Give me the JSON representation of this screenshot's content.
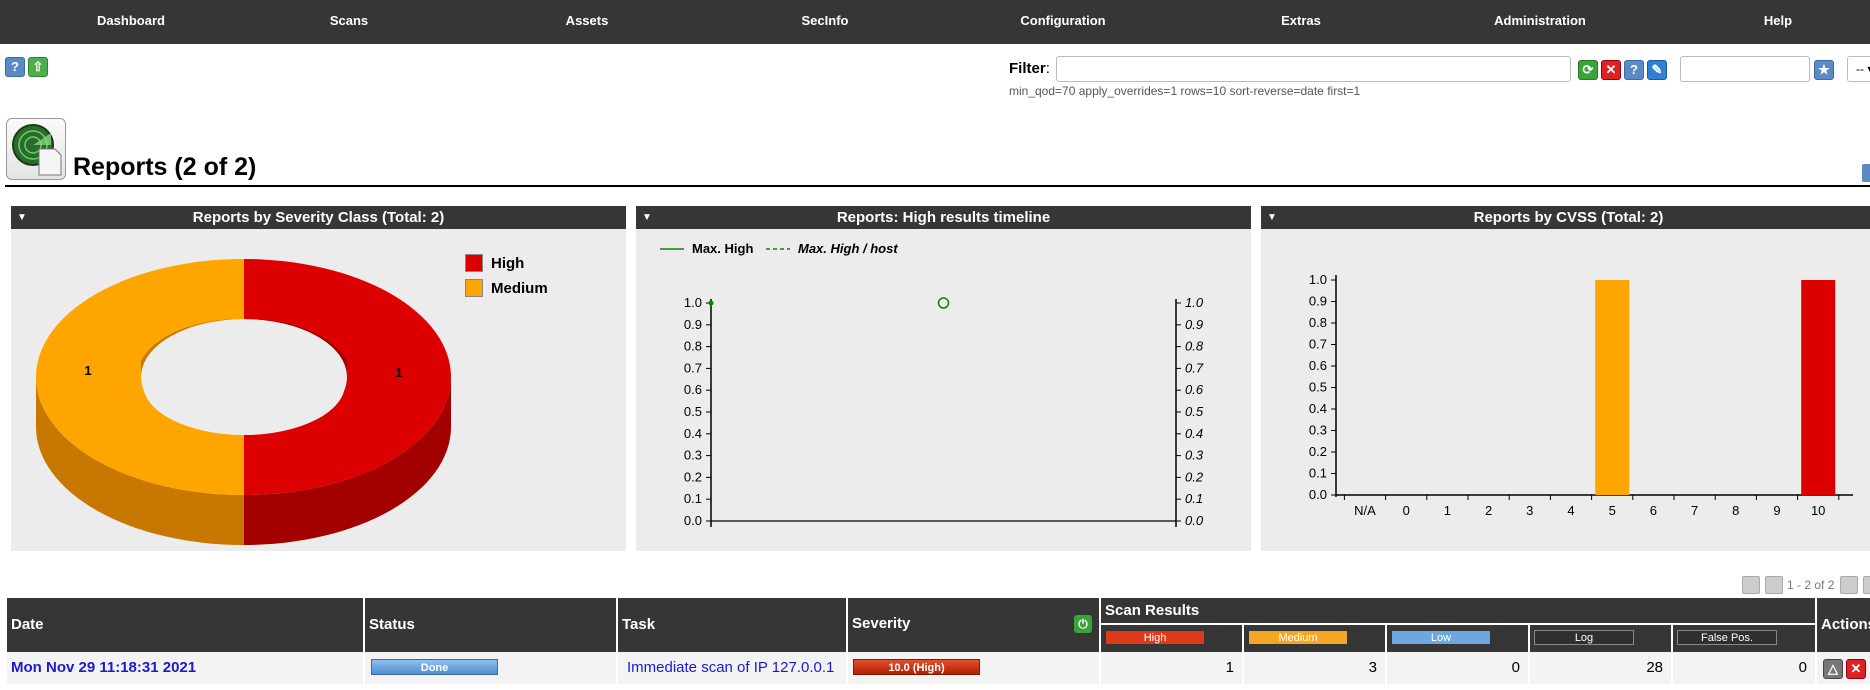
{
  "nav": {
    "items": [
      "Dashboard",
      "Scans",
      "Assets",
      "SecInfo",
      "Configuration",
      "Extras",
      "Administration",
      "Help"
    ]
  },
  "toolbar": {
    "help_icon": "?",
    "upload_icon": "⇧"
  },
  "filter": {
    "label": "Filter",
    "colon": ":",
    "value": "",
    "query_text": "min_qod=70 apply_overrides=1 rows=10 sort-reverse=date first=1",
    "select_value": "-- ▾"
  },
  "page": {
    "title": "Reports (2 of 2)"
  },
  "panels": [
    {
      "title": "Reports by Severity Class (Total: 2)"
    },
    {
      "title": "Reports: High results timeline"
    },
    {
      "title": "Reports by CVSS (Total: 2)"
    }
  ],
  "colors": {
    "high": "#dd0000",
    "medium": "#ffa500",
    "low": "#6ea6df",
    "log": "#333333",
    "nav": "#363636"
  },
  "chart_data": [
    {
      "type": "pie",
      "title": "Reports by Severity Class (Total: 2)",
      "categories": [
        "High",
        "Medium"
      ],
      "values": [
        1,
        1
      ],
      "value_labels": [
        "1",
        "1"
      ],
      "legend": "top-right",
      "donut": true
    },
    {
      "type": "line",
      "title": "Reports: High results timeline",
      "series": [
        {
          "name": "Max. High",
          "values": [
            1.0
          ]
        },
        {
          "name": "Max. High / host",
          "values": [
            1.0
          ]
        }
      ],
      "ylim": [
        0.0,
        1.0
      ],
      "y_ticks": [
        "0.0",
        "0.1",
        "0.2",
        "0.3",
        "0.4",
        "0.5",
        "0.6",
        "0.7",
        "0.8",
        "0.9",
        "1.0"
      ],
      "legend": "top-left"
    },
    {
      "type": "bar",
      "title": "Reports by CVSS (Total: 2)",
      "categories": [
        "N/A",
        "0",
        "1",
        "2",
        "3",
        "4",
        "5",
        "6",
        "7",
        "8",
        "9",
        "10"
      ],
      "values": [
        0,
        0,
        0,
        0,
        0,
        0,
        1.0,
        0,
        0,
        0,
        0,
        1.0
      ],
      "bar_colors": [
        "#ffa500",
        "#ffa500",
        "#ffa500",
        "#ffa500",
        "#ffa500",
        "#ffa500",
        "#ffa500",
        "#ffa500",
        "#ffa500",
        "#ffa500",
        "#ffa500",
        "#dd0000"
      ],
      "ylim": [
        0.0,
        1.0
      ],
      "y_ticks": [
        "0.0",
        "0.1",
        "0.2",
        "0.3",
        "0.4",
        "0.5",
        "0.6",
        "0.7",
        "0.8",
        "0.9",
        "1.0"
      ]
    }
  ],
  "pagination": {
    "text": "1 - 2 of 2"
  },
  "table": {
    "headers": {
      "date": "Date",
      "status": "Status",
      "task": "Task",
      "severity": "Severity",
      "scan_results": "Scan Results",
      "actions": "Actions"
    },
    "sub_headers": [
      "High",
      "Medium",
      "Low",
      "Log",
      "False Pos."
    ],
    "rows": [
      {
        "date": "Mon Nov 29 11:18:31 2021",
        "status": "Done",
        "task": "Immediate scan of IP 127.0.0.1",
        "severity": "10.0 (High)",
        "high": "1",
        "medium": "3",
        "low": "0",
        "log": "28",
        "false_pos": "0"
      }
    ]
  }
}
